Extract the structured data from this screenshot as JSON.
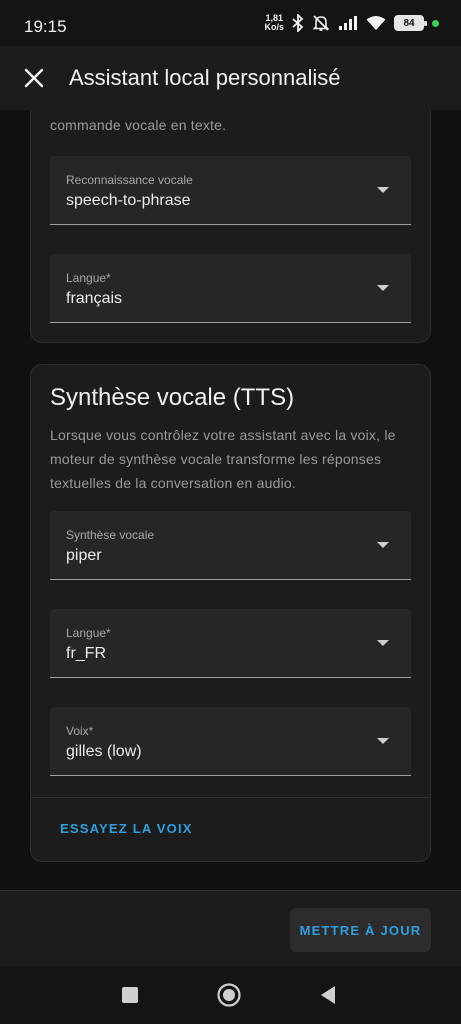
{
  "status_bar": {
    "time": "19:15",
    "net_speed_value": "1,81",
    "net_speed_unit": "Ko/s",
    "battery": "84"
  },
  "app_bar": {
    "title": "Assistant local personnalisé"
  },
  "stt_card": {
    "description_tail": "commande vocale en texte.",
    "engine_select": {
      "label": "Reconnaissance vocale",
      "value": "speech-to-phrase"
    },
    "language_select": {
      "label": "Langue*",
      "value": "français"
    }
  },
  "tts_card": {
    "title": "Synthèse vocale (TTS)",
    "description": "Lorsque vous contrôlez votre assistant avec la voix, le moteur de synthèse vocale transforme les réponses textuelles de la conversation en audio.",
    "engine_select": {
      "label": "Synthèse vocale",
      "value": "piper"
    },
    "language_select": {
      "label": "Langue*",
      "value": "fr_FR"
    },
    "voice_select": {
      "label": "Voix*",
      "value": "gilles (low)"
    },
    "try_voice_label": "ESSAYEZ LA VOIX"
  },
  "footer": {
    "update_label": "METTRE À JOUR"
  },
  "colors": {
    "accent": "#2f9fe0",
    "surface": "#1c1c1c",
    "field": "#262626",
    "background": "#111111"
  }
}
